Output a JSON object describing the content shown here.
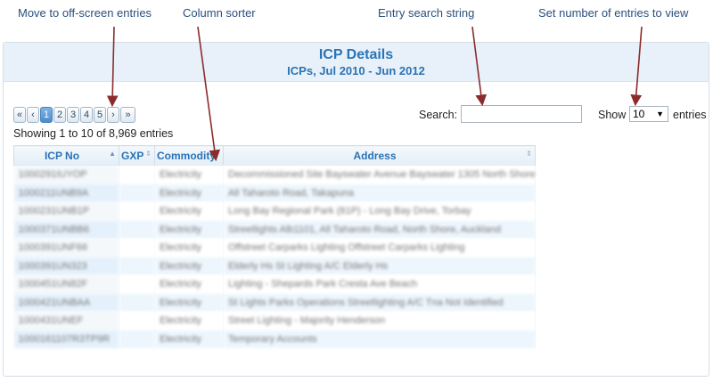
{
  "callouts": {
    "move": "Move to off-screen entries",
    "sorter": "Column sorter",
    "search": "Entry search string",
    "entries": "Set number of entries to view"
  },
  "panel": {
    "title": "ICP Details",
    "subtitle": "ICPs, Jul 2010 - Jun 2012"
  },
  "pagination": {
    "first": "«",
    "prev": "‹",
    "pages": [
      "1",
      "2",
      "3",
      "4",
      "5"
    ],
    "next": "›",
    "last": "»"
  },
  "info": "Showing 1 to 10 of 8,969 entries",
  "search": {
    "label": "Search:",
    "value": ""
  },
  "length": {
    "label": "Show",
    "value": "10",
    "suffix": "entries"
  },
  "table": {
    "columns": [
      "ICP No",
      "GXP",
      "Commodity",
      "Address"
    ],
    "rows": [
      [
        "1000291IUYOP",
        "",
        "Electricity",
        "Decommissioned Site Bayswater Avenue Bayswater 1305 North Shore"
      ],
      [
        "1000211UNB9A",
        "",
        "Electricity",
        "All Taharoto Road, Takapuna"
      ],
      [
        "1000231UNB1P",
        "",
        "Electricity",
        "Long Bay Regional Park (81P) - Long Bay Drive, Torbay"
      ],
      [
        "1000371UNBB6",
        "",
        "Electricity",
        "Streetlights Alb1101, All Taharoto Road, North Shore, Auckland"
      ],
      [
        "1000391UNF66",
        "",
        "Electricity",
        "Offstreet Carparks Lighting Offstreet Carparks Lighting"
      ],
      [
        "1000391UN323",
        "",
        "Electricity",
        "Elderly Hs St Lighting A/C Elderly Hs"
      ],
      [
        "1000451UN82F",
        "",
        "Electricity",
        "Lighting - Shepards Park Cresta Ave Beach"
      ],
      [
        "1000421UNBAA",
        "",
        "Electricity",
        "St Lights Parks Operations Streetlighting A/C Tna Not Identified"
      ],
      [
        "1000431UNEF",
        "",
        "Electricity",
        "Street Lighting - Majority Henderson"
      ],
      [
        "1000161107R3TP9R",
        "",
        "Electricity",
        "Temporary Accounts"
      ]
    ]
  }
}
